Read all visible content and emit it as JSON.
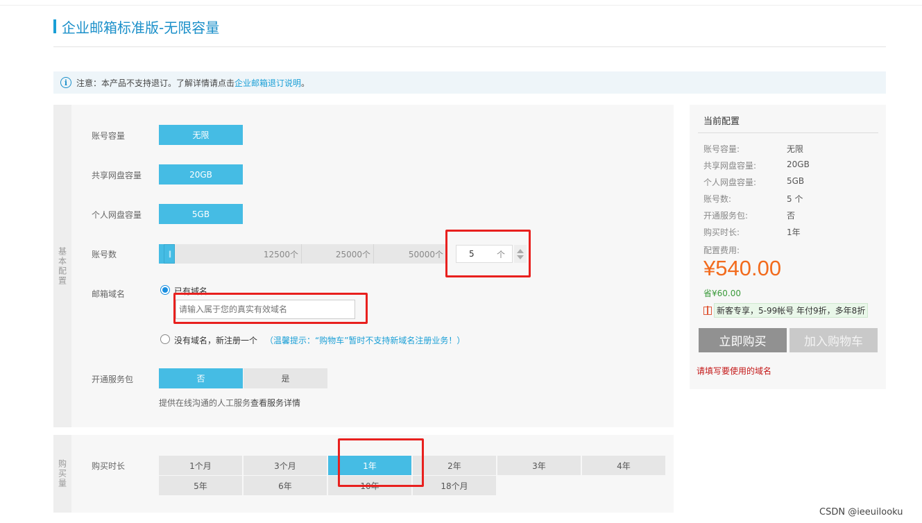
{
  "title": "企业邮箱标准版-无限容量",
  "notice": {
    "prefix": "注意：本产品不支持退订。了解详情请点击",
    "link": "企业邮箱退订说明",
    "suffix": "。"
  },
  "basic": {
    "side_label": "基本配置",
    "capacity": {
      "label": "账号容量",
      "value": "无限"
    },
    "shared_disk": {
      "label": "共享网盘容量",
      "value": "20GB"
    },
    "personal_disk": {
      "label": "个人网盘容量",
      "value": "5GB"
    },
    "accounts": {
      "label": "账号数",
      "ticks": [
        "12500个",
        "25000个",
        "50000个"
      ],
      "value": "5",
      "unit": "个",
      "slider_fraction": 0.0001
    },
    "domain": {
      "label": "邮箱域名",
      "option_existing": "已有域名",
      "input_placeholder": "请输入属于您的真实有效域名",
      "option_new": "没有域名，新注册一个",
      "tip": "（温馨提示：“购物车”暂时不支持新域名注册业务！）"
    },
    "service": {
      "label": "开通服务包",
      "options": [
        "否",
        "是"
      ],
      "selected": "否",
      "desc": "提供在线沟通的人工服务",
      "desc_link": "查看服务详情"
    }
  },
  "buy": {
    "side_label": "购买量",
    "label": "购买时长",
    "options_row1": [
      "1个月",
      "3个月",
      "1年",
      "2年",
      "3年",
      "4年"
    ],
    "options_row2": [
      "5年",
      "6年",
      "10年",
      "18个月"
    ],
    "selected": "1年"
  },
  "summary": {
    "header": "当前配置",
    "rows": [
      {
        "k": "账号容量:",
        "v": "无限"
      },
      {
        "k": "共享网盘容量:",
        "v": "20GB"
      },
      {
        "k": "个人网盘容量:",
        "v": "5GB"
      },
      {
        "k": "账号数:",
        "v": "5 个"
      },
      {
        "k": "开通服务包:",
        "v": "否"
      },
      {
        "k": "购买时长:",
        "v": "1年"
      }
    ],
    "fee_label": "配置费用:",
    "price": "¥540.00",
    "save": "省¥60.00",
    "promo": "新客专享，5-99帐号 年付9折，多年8折",
    "buy_now": "立即购买",
    "add_cart": "加入购物车",
    "error": "请填写要使用的域名"
  },
  "watermark": "CSDN @ieeuilooku",
  "colors": {
    "accent": "#45bce4",
    "price": "#f26b1d",
    "highlight": "#e8201e"
  }
}
